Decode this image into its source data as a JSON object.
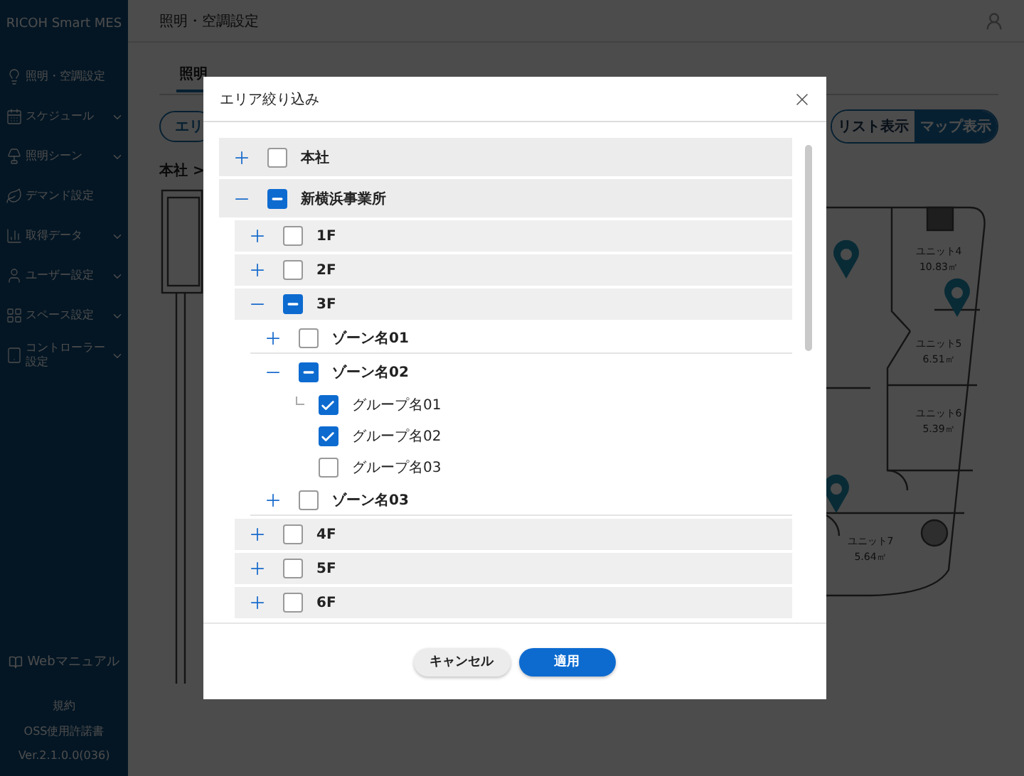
{
  "sidebar": {
    "brand": "RICOH Smart MES",
    "items": [
      {
        "label": "照明・空調設定",
        "has_submenu": false
      },
      {
        "label": "スケジュール",
        "has_submenu": true
      },
      {
        "label": "照明シーン",
        "has_submenu": true
      },
      {
        "label": "デマンド設定",
        "has_submenu": false
      },
      {
        "label": "取得データ",
        "has_submenu": true
      },
      {
        "label": "ユーザー設定",
        "has_submenu": true
      },
      {
        "label": "スペース設定",
        "has_submenu": true
      },
      {
        "label": "コントローラー設定",
        "has_submenu": true
      }
    ],
    "manual_link": "Webマニュアル",
    "terms_link": "規約",
    "oss_link": "OSS使用許諾書",
    "version": "Ver.2.1.0.0(036)"
  },
  "header": {
    "title": "照明・空調設定"
  },
  "tabs": [
    {
      "label": "照明",
      "selected": true
    }
  ],
  "area_button": "エリ",
  "breadcrumb": "本社 >",
  "view_toggle": [
    {
      "label": "リスト表示",
      "selected": false
    },
    {
      "label": "マップ表示",
      "selected": true
    }
  ],
  "map": {
    "units": [
      {
        "name": "ユニット4",
        "area": "10.83㎡"
      },
      {
        "name": "ユニット5",
        "area": "6.51㎡"
      },
      {
        "name": "ユニット6",
        "area": "5.39㎡"
      },
      {
        "name": "ユニット7",
        "area": "5.64㎡"
      }
    ]
  },
  "dialog": {
    "title": "エリア絞り込み",
    "tree": [
      {
        "label": "本社",
        "kind": "branch",
        "expanded": false,
        "checked": false,
        "partial": false
      },
      {
        "label": "新横浜事業所",
        "kind": "branch",
        "expanded": true,
        "checked": true,
        "partial": true,
        "children": [
          {
            "label": "1F",
            "kind": "branch",
            "expanded": false,
            "checked": false,
            "partial": false
          },
          {
            "label": "2F",
            "kind": "branch",
            "expanded": false,
            "checked": false,
            "partial": false
          },
          {
            "label": "3F",
            "kind": "branch",
            "expanded": true,
            "checked": true,
            "partial": true,
            "children": [
              {
                "label": "ゾーン名01",
                "kind": "branch",
                "expanded": false,
                "checked": false,
                "partial": false
              },
              {
                "label": "ゾーン名02",
                "kind": "branch",
                "expanded": true,
                "checked": true,
                "partial": true,
                "children": [
                  {
                    "label": "グループ名01",
                    "kind": "leaf",
                    "checked": true,
                    "partial": false
                  },
                  {
                    "label": "グループ名02",
                    "kind": "leaf",
                    "checked": true,
                    "partial": false
                  },
                  {
                    "label": "グループ名03",
                    "kind": "leaf",
                    "checked": false,
                    "partial": false
                  }
                ]
              },
              {
                "label": "ゾーン名03",
                "kind": "branch",
                "expanded": false,
                "checked": false,
                "partial": false
              }
            ]
          },
          {
            "label": "4F",
            "kind": "branch",
            "expanded": false,
            "checked": false,
            "partial": false
          },
          {
            "label": "5F",
            "kind": "branch",
            "expanded": false,
            "checked": false,
            "partial": false
          },
          {
            "label": "6F",
            "kind": "branch",
            "expanded": false,
            "checked": false,
            "partial": false
          }
        ]
      }
    ],
    "cancel_button": "キャンセル",
    "apply_button": "適用"
  }
}
